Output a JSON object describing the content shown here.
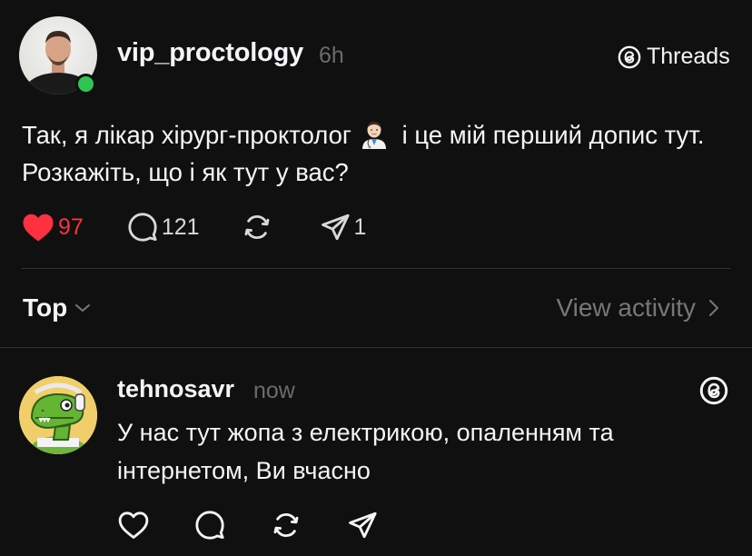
{
  "post": {
    "username": "vip_proctology",
    "time": "6h",
    "app_badge": "Threads",
    "text_part1": "Так, я лікар хірург-проктолог",
    "text_part2": " і це мій перший допис тут. Розкажіть, що і як тут у вас?",
    "likes": "97",
    "comments": "121",
    "shares": "1"
  },
  "sort": {
    "label": "Top",
    "view_activity": "View activity"
  },
  "reply": {
    "username": "tehnosavr",
    "time": "now",
    "text": "У нас тут жопа з електрикою, опаленням та інтернетом, Ви вчасно"
  },
  "colors": {
    "background": "#101010",
    "like_red": "#ff3040",
    "online_green": "#2ec653",
    "muted": "#777777"
  },
  "icons": [
    "heart-icon",
    "comment-icon",
    "repost-icon",
    "share-icon",
    "threads-logo-icon",
    "chevron-down-icon",
    "chevron-right-icon",
    "doctor-emoji-icon"
  ]
}
